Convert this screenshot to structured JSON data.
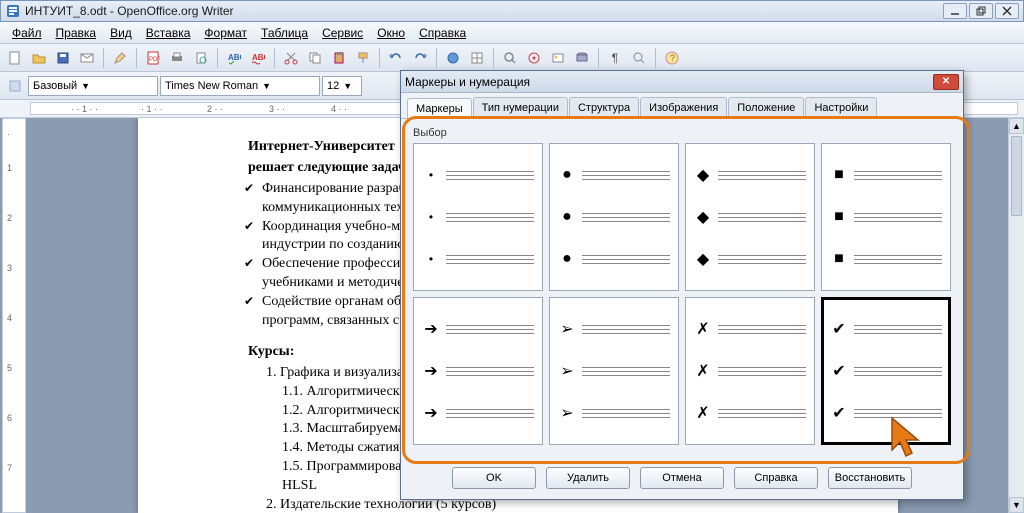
{
  "window": {
    "title": "ИНТУИТ_8.odt - OpenOffice.org Writer"
  },
  "menu": [
    "Файл",
    "Правка",
    "Вид",
    "Вставка",
    "Формат",
    "Таблица",
    "Сервис",
    "Окно",
    "Справка"
  ],
  "toolbar2": {
    "style": "Базовый",
    "font": "Times New Roman",
    "size": "12"
  },
  "ruler_marks": [
    "1",
    "",
    "1",
    "2",
    "3",
    "4"
  ],
  "document": {
    "title1": "Интернет-Университет",
    "title2": "решает следующие задачи",
    "bullets": [
      "Финансирование разработки",
      "коммуникационных технологий",
      "Координация учебно-методической",
      "индустрии по созданию",
      "Обеспечение профессионального",
      "учебниками и методическими",
      "Содействие органам образования",
      "программ, связанных с"
    ],
    "courses_heading": "Курсы:",
    "courses": [
      "1.  Графика и визуализация",
      "1.1.   Алгоритмические",
      "1.2.   Алгоритмические",
      "1.3.   Масштабируемая",
      "1.4.   Методы сжатия",
      "1.5.   Программирование",
      "          HLSL",
      "2.  Издательские технологии (5 курсов)"
    ]
  },
  "dialog": {
    "title": "Маркеры и нумерация",
    "tabs": [
      "Маркеры",
      "Тип нумерации",
      "Структура",
      "Изображения",
      "Положение",
      "Настройки"
    ],
    "active_tab": 0,
    "selection_label": "Выбор",
    "buttons": {
      "ok": "OK",
      "delete": "Удалить",
      "cancel": "Отмена",
      "help": "Справка",
      "reset": "Восстановить"
    },
    "bullet_marks": [
      "•",
      "●",
      "◆",
      "■",
      "➔",
      "➢",
      "✗",
      "✔"
    ],
    "selected_index": 7
  }
}
